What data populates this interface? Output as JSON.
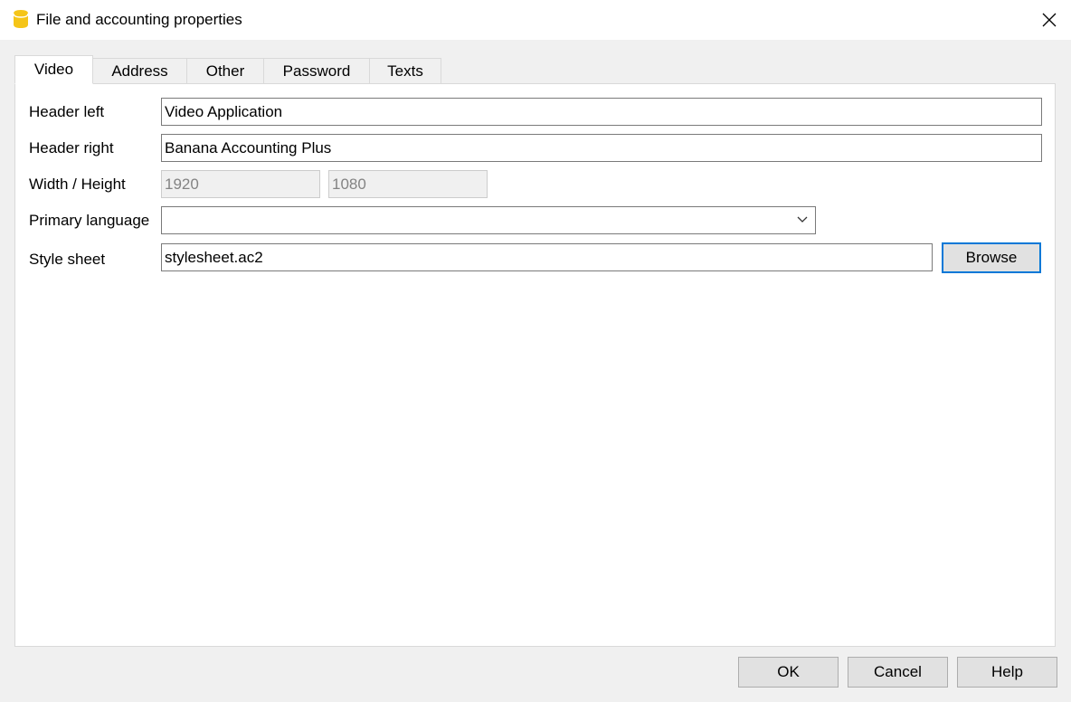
{
  "window": {
    "title": "File and accounting properties"
  },
  "tabs": [
    {
      "label": "Video",
      "active": true
    },
    {
      "label": "Address",
      "active": false
    },
    {
      "label": "Other",
      "active": false
    },
    {
      "label": "Password",
      "active": false
    },
    {
      "label": "Texts",
      "active": false
    }
  ],
  "form": {
    "header_left": {
      "label": "Header left",
      "value": "Video Application"
    },
    "header_right": {
      "label": "Header right",
      "value": "Banana Accounting Plus"
    },
    "width_height": {
      "label": "Width / Height",
      "width": "1920",
      "height": "1080"
    },
    "primary_language": {
      "label": "Primary language",
      "value": ""
    },
    "style_sheet": {
      "label": "Style sheet",
      "value": "stylesheet.ac2",
      "browse_label": "Browse"
    }
  },
  "footer": {
    "ok_label": "OK",
    "cancel_label": "Cancel",
    "help_label": "Help"
  },
  "colors": {
    "app_icon": "#f5c518",
    "focus_border": "#0078d7"
  },
  "icons": [
    "app-icon",
    "close-icon",
    "chevron-down-icon"
  ]
}
